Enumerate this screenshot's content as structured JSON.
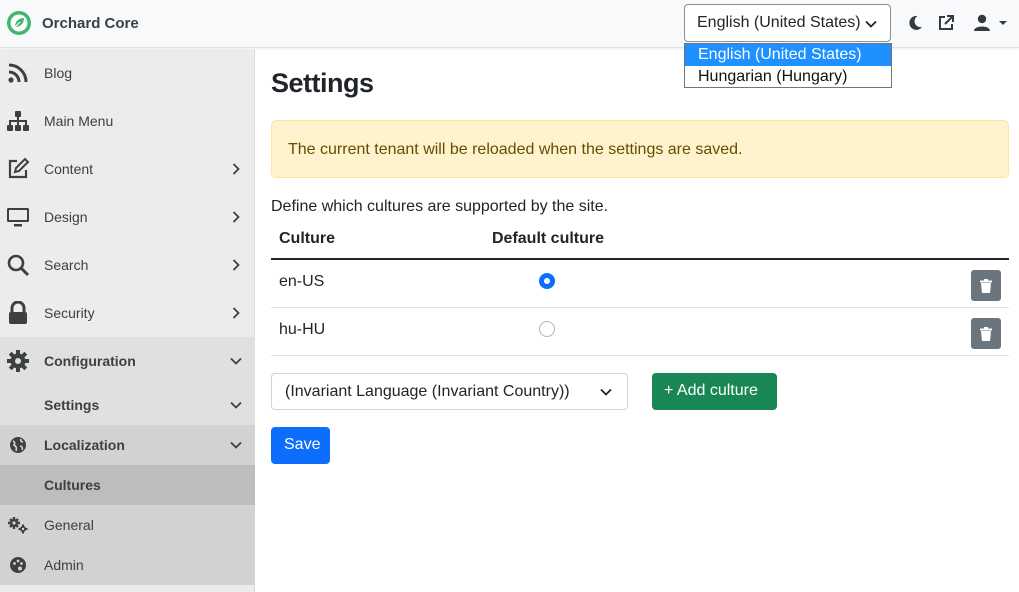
{
  "header": {
    "brand": "Orchard Core",
    "language_select": {
      "value": "English (United States)",
      "options": [
        "English (United States)",
        "Hungarian (Hungary)"
      ]
    },
    "icons": [
      "moon-icon",
      "external-link-icon",
      "user-icon",
      "caret-down-icon"
    ]
  },
  "sidebar": {
    "items": [
      {
        "label": "Blog",
        "icon": "rss-icon"
      },
      {
        "label": "Main Menu",
        "icon": "sitemap-icon"
      },
      {
        "label": "Content",
        "icon": "edit-icon"
      },
      {
        "label": "Design",
        "icon": "monitor-icon"
      },
      {
        "label": "Search",
        "icon": "search-icon"
      },
      {
        "label": "Security",
        "icon": "lock-icon"
      },
      {
        "label": "Configuration",
        "icon": "cog-icon"
      },
      {
        "label": "Settings"
      },
      {
        "label": "Localization",
        "icon": "globe-icon"
      },
      {
        "label": "Cultures"
      },
      {
        "label": "General",
        "icon": "cogs-icon"
      },
      {
        "label": "Admin",
        "icon": "palette-icon"
      }
    ]
  },
  "main": {
    "title": "Settings",
    "alert": "The current tenant will be reloaded when the settings are saved.",
    "description": "Define which cultures are supported by the site.",
    "table": {
      "columns": [
        "Culture",
        "Default culture"
      ],
      "rows": [
        {
          "culture": "en-US",
          "default": true
        },
        {
          "culture": "hu-HU",
          "default": false
        }
      ]
    },
    "culture_select": "(Invariant Language (Invariant Country))",
    "add_button": "+ Add culture",
    "save_button": "Save"
  },
  "colors": {
    "primary": "#0d6efd",
    "success": "#198754",
    "secondary": "#6c757d",
    "warning_bg": "#fff3cd",
    "brand_green": "#41b670"
  }
}
